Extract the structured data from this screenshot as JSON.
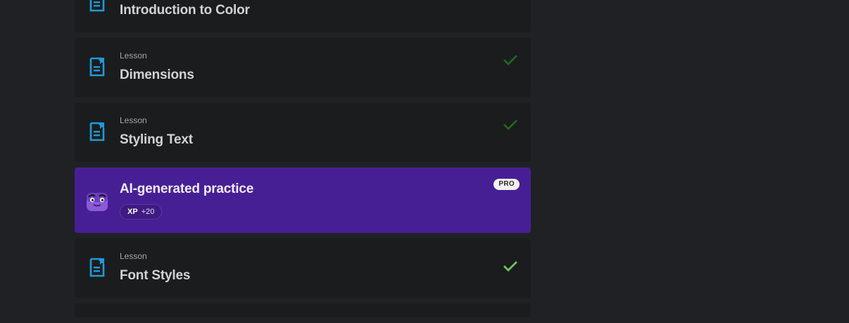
{
  "colors": {
    "background": "#202124",
    "card": "#1b1c1e",
    "practice_card": "#471f95",
    "doc_icon": "#1e9bd8",
    "check_done": "#1f6b1f",
    "check_active": "#6dc55f"
  },
  "lessons": [
    {
      "kind": "",
      "title": "Introduction to Color",
      "icon": "document-icon",
      "completed": false
    },
    {
      "kind": "Lesson",
      "title": "Dimensions",
      "icon": "document-icon",
      "completed": true
    },
    {
      "kind": "Lesson",
      "title": "Styling Text",
      "icon": "document-icon",
      "completed": true
    }
  ],
  "practice": {
    "title": "AI-generated practice",
    "xp_label": "XP",
    "xp_value": "+20",
    "badge": "PRO",
    "icon": "bot-icon"
  },
  "lessons_after": [
    {
      "kind": "Lesson",
      "title": "Font Styles",
      "icon": "document-icon",
      "completed": true
    }
  ]
}
